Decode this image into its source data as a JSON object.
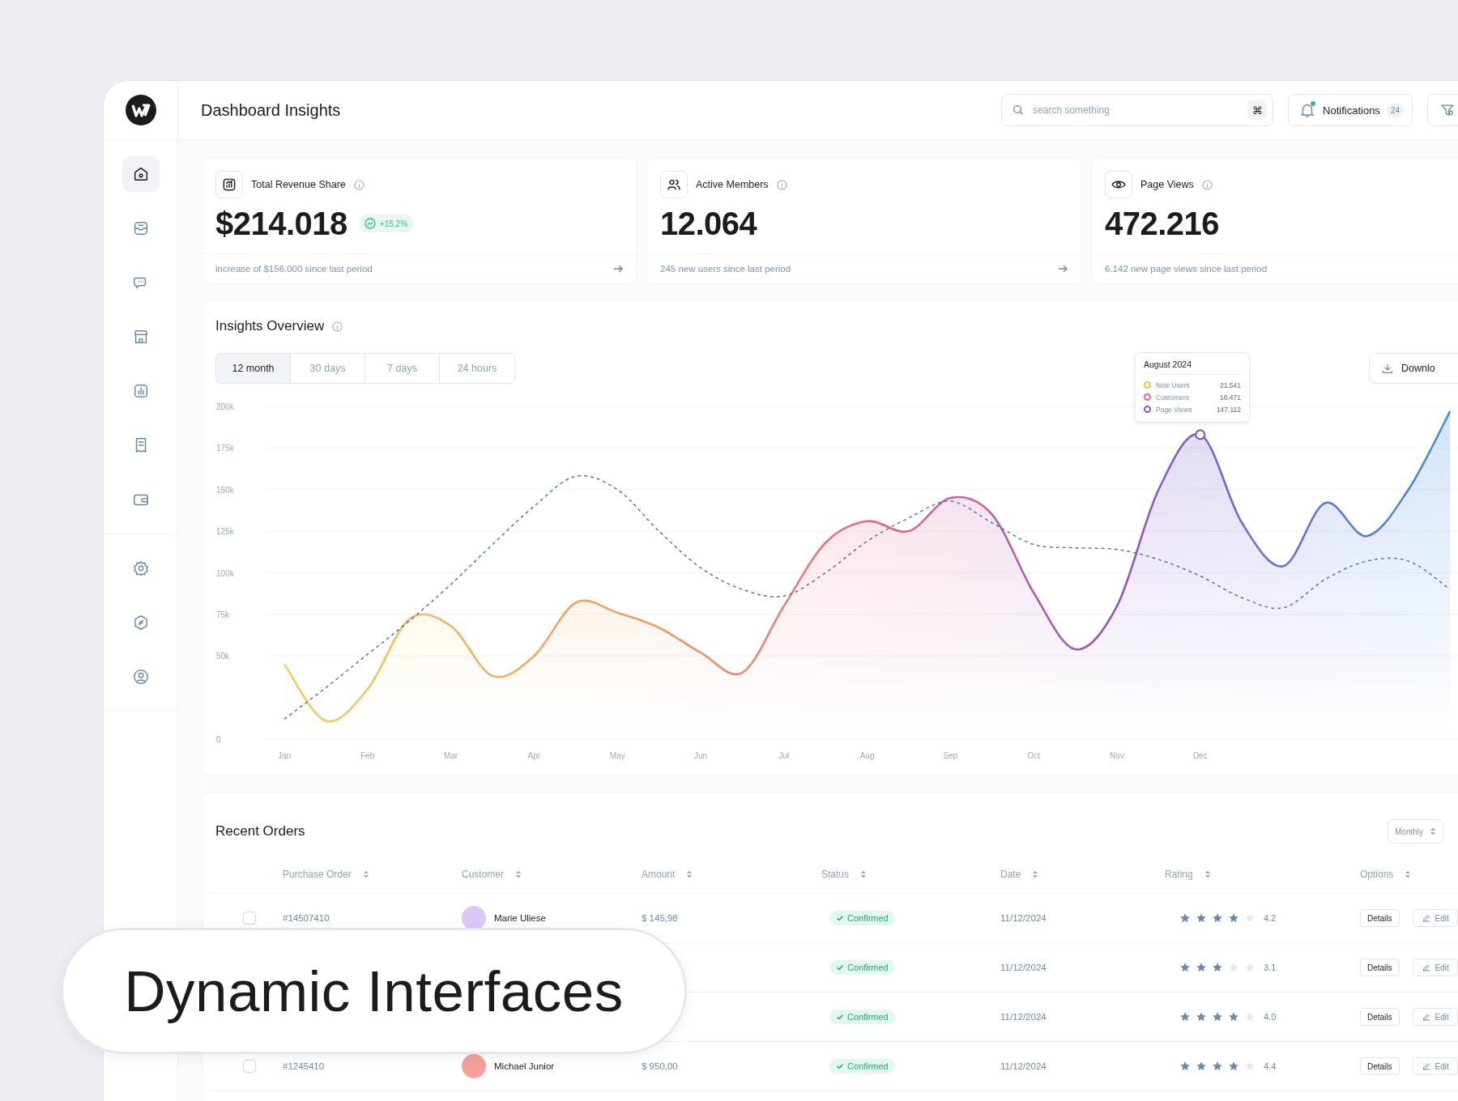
{
  "sidebar": {
    "groups": [
      {
        "items": [
          {
            "selected": true
          },
          {
            "selected": false
          },
          {
            "selected": false
          },
          {
            "selected": false
          },
          {
            "selected": false
          },
          {
            "selected": false
          },
          {
            "selected": false
          }
        ]
      },
      {
        "items": [
          {
            "selected": false
          },
          {
            "selected": false
          },
          {
            "selected": false
          }
        ]
      }
    ]
  },
  "header": {
    "title": "Dashboard Insights",
    "search": {
      "placeholder": "search something",
      "shortcut": "⌘"
    },
    "notifications": {
      "label": "Notifications",
      "count": "24",
      "unread": true
    }
  },
  "stats": [
    {
      "title": "Total Revenue Share",
      "value": "$214.018",
      "badge": "+15,2%",
      "footer": "increase of $156.000 since last period",
      "arrow": true
    },
    {
      "title": "Active Members",
      "value": "12.064",
      "footer": "245 new users since last period",
      "arrow": true
    },
    {
      "title": "Page Views",
      "value": "472.216",
      "footer": "6.142 new page views since last period",
      "arrow": false
    }
  ],
  "insights": {
    "title": "Insights Overview",
    "tabs": [
      {
        "label": "12 month",
        "selected": true
      },
      {
        "label": "30 days",
        "selected": false
      },
      {
        "label": "7 days",
        "selected": false
      },
      {
        "label": "24 hours",
        "selected": false
      }
    ],
    "download": "Downlo",
    "tooltip": {
      "title": "August 2024",
      "rows": [
        {
          "label": "New Users",
          "value": "21.541",
          "color": "#f2c23c"
        },
        {
          "label": "Customers",
          "value": "16.471",
          "color": "#e76a8a"
        },
        {
          "label": "Page Views",
          "value": "147.112",
          "color": "#8e55c4"
        }
      ]
    },
    "chart_data": {
      "type": "line",
      "categories": [
        "Jan",
        null,
        "Feb",
        null,
        "Mar",
        null,
        "Apr",
        null,
        "May",
        null,
        "Jun",
        null,
        "Jul",
        null,
        "Aug",
        null,
        "Sep",
        null,
        "Oct",
        null,
        "Nov",
        null,
        "Dec",
        null,
        null,
        null,
        null,
        null,
        null
      ],
      "series": [
        {
          "color": "#e76a8a",
          "type": "area",
          "line_style": "solid",
          "values": [
            45000,
            11000,
            30000,
            72000,
            68000,
            38000,
            50000,
            82000,
            76000,
            67000,
            52000,
            40000,
            80000,
            118000,
            131000,
            125000,
            145000,
            135000,
            88000,
            54000,
            80000,
            150000,
            183000,
            130000,
            104000,
            142000,
            122000,
            150000,
            197000
          ]
        },
        {
          "color": "#5b7a94",
          "type": "line",
          "line_style": "dashed",
          "values": [
            12000,
            31000,
            51000,
            71000,
            93000,
            117000,
            140000,
            158000,
            150000,
            125000,
            103000,
            90000,
            86000,
            100000,
            119000,
            133000,
            143000,
            130000,
            117000,
            115000,
            114000,
            108000,
            98000,
            85000,
            79000,
            96000,
            107000,
            107000,
            90000
          ]
        }
      ],
      "ylim": [
        0,
        200000
      ],
      "grid": true,
      "yticks": [
        {
          "value": 0,
          "label": "0"
        },
        {
          "value": 50000,
          "label": "50k"
        },
        {
          "value": 75000,
          "label": "75k"
        },
        {
          "value": 100000,
          "label": "100k"
        },
        {
          "value": 125000,
          "label": "125k"
        },
        {
          "value": 150000,
          "label": "150k"
        },
        {
          "value": 175000,
          "label": "175k"
        },
        {
          "value": 200000,
          "label": "200k"
        }
      ]
    }
  },
  "orders": {
    "title": "Recent Orders",
    "period": "Monthly",
    "columns": [
      {
        "label": "Purchase Order",
        "sortable": true
      },
      {
        "label": "Customer",
        "sortable": true
      },
      {
        "label": "Amount",
        "sortable": true
      },
      {
        "label": "Status",
        "sortable": true
      },
      {
        "label": "Date",
        "sortable": true
      },
      {
        "label": "Rating",
        "sortable": true
      },
      {
        "label": "Options",
        "sortable": true
      }
    ],
    "rows": [
      {
        "checked": false,
        "order": "#14507410",
        "customer": {
          "name": "Marie Uliese",
          "color": "#d8c9f6"
        },
        "amount": "$ 145,98",
        "status": {
          "text": "Confirmed",
          "kind": "success"
        },
        "date": "11/12/2024",
        "stars": 4,
        "rating": "4.2",
        "actions": [
          "Details",
          "Edit"
        ]
      },
      {
        "status": {
          "text": "Confirmed",
          "kind": "success"
        },
        "date": "11/12/2024",
        "stars": 3,
        "rating": "3.1",
        "actions": [
          "Details",
          "Edit"
        ]
      },
      {
        "status": {
          "text": "Confirmed",
          "kind": "success"
        },
        "date": "11/12/2024",
        "stars": 4,
        "rating": "4.0",
        "actions": [
          "Details",
          "Edit"
        ]
      },
      {
        "checked": false,
        "order": "#1245410",
        "customer": {
          "name": "Michael Junior",
          "color": "#f4a09c"
        },
        "amount": "$ 950,00",
        "status": {
          "text": "Confirmed",
          "kind": "success"
        },
        "date": "11/12/2024",
        "stars": 4,
        "rating": "4.4",
        "actions": [
          "Details",
          "Edit"
        ]
      }
    ]
  },
  "overlay_label": "Dynamic Interfaces"
}
